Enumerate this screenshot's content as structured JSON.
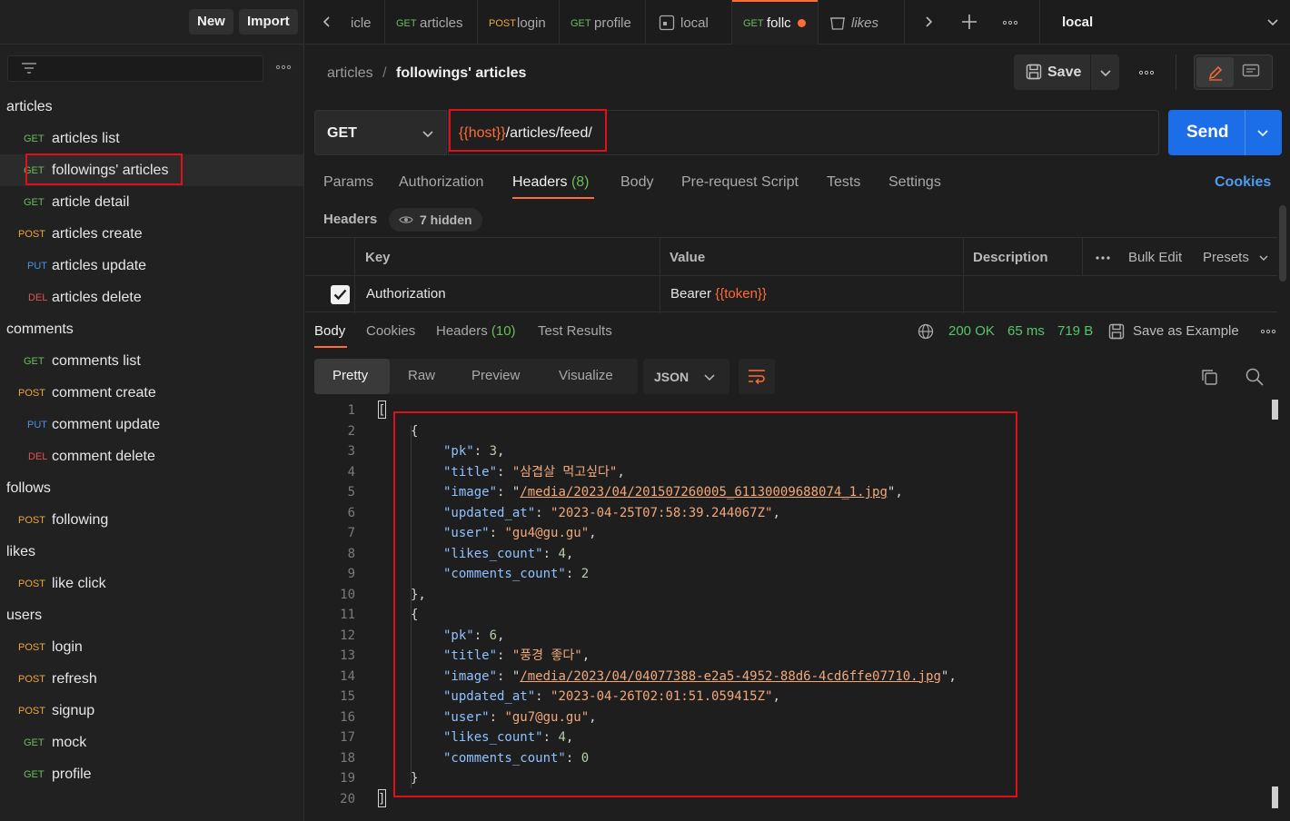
{
  "sidebar": {
    "new_label": "New",
    "import_label": "Import",
    "folders": [
      {
        "name": "articles",
        "items": [
          {
            "method": "GET",
            "label": "articles list"
          },
          {
            "method": "GET",
            "label": "followings' articles"
          },
          {
            "method": "GET",
            "label": "article detail"
          },
          {
            "method": "POST",
            "label": "articles create"
          },
          {
            "method": "PUT",
            "label": "articles update"
          },
          {
            "method": "DEL",
            "label": "articles delete"
          }
        ]
      },
      {
        "name": "comments",
        "items": [
          {
            "method": "GET",
            "label": "comments list"
          },
          {
            "method": "POST",
            "label": "comment create"
          },
          {
            "method": "PUT",
            "label": "comment update"
          },
          {
            "method": "DEL",
            "label": "comment delete"
          }
        ]
      },
      {
        "name": "follows",
        "items": [
          {
            "method": "POST",
            "label": "following"
          }
        ]
      },
      {
        "name": "likes",
        "items": [
          {
            "method": "POST",
            "label": "like click"
          }
        ]
      },
      {
        "name": "users",
        "items": [
          {
            "method": "POST",
            "label": "login"
          },
          {
            "method": "POST",
            "label": "refresh"
          },
          {
            "method": "POST",
            "label": "signup"
          },
          {
            "method": "GET",
            "label": "mock"
          },
          {
            "method": "GET",
            "label": "profile"
          }
        ]
      }
    ]
  },
  "tabs": [
    {
      "method": "",
      "label": "icle"
    },
    {
      "method": "GET",
      "label": "articles"
    },
    {
      "method": "POST",
      "label": "login"
    },
    {
      "method": "GET",
      "label": "profile"
    },
    {
      "method": "",
      "label": "local"
    },
    {
      "method": "GET",
      "label": "follc"
    },
    {
      "method": "",
      "label": "likes"
    }
  ],
  "environment": "local",
  "breadcrumb": {
    "parent": "articles",
    "separator": "/",
    "current": "followings' articles"
  },
  "toolbar": {
    "save_label": "Save"
  },
  "request": {
    "method": "GET",
    "url_var": "{{host}}",
    "url_path": "/articles/feed/",
    "send_label": "Send"
  },
  "request_tabs": {
    "params": "Params",
    "authorization": "Authorization",
    "headers": "Headers",
    "headers_count": "(8)",
    "body": "Body",
    "pre_request": "Pre-request Script",
    "tests": "Tests",
    "settings": "Settings",
    "cookies": "Cookies"
  },
  "headers_section": {
    "title": "Headers",
    "hidden": "7 hidden"
  },
  "headers_table": {
    "col_key": "Key",
    "col_value": "Value",
    "col_description": "Description",
    "bulk_edit": "Bulk Edit",
    "presets": "Presets",
    "rows": [
      {
        "checked": true,
        "key": "Authorization",
        "value_prefix": "Bearer ",
        "value_var": "{{token}}"
      }
    ]
  },
  "response_tabs": {
    "body": "Body",
    "cookies": "Cookies",
    "headers": "Headers",
    "headers_count": "(10)",
    "test_results": "Test Results"
  },
  "response_status": {
    "status": "200 OK",
    "time": "65 ms",
    "size": "719 B",
    "save_example": "Save as Example"
  },
  "response_view": {
    "modes": [
      "Pretty",
      "Raw",
      "Preview",
      "Visualize"
    ],
    "format": "JSON"
  },
  "code_lines": [
    {
      "n": "1",
      "t": "["
    },
    {
      "n": "2",
      "t": "{"
    },
    {
      "n": "3",
      "key": "\"pk\"",
      "val": "3",
      "vt": "n"
    },
    {
      "n": "4",
      "key": "\"title\"",
      "val": "\"삼겹살 먹고싶다\"",
      "vt": "s"
    },
    {
      "n": "5",
      "key": "\"image\"",
      "val": "/media/2023/04/201507260005_61130009688074_1.jpg",
      "vt": "u"
    },
    {
      "n": "6",
      "key": "\"updated_at\"",
      "val": "\"2023-04-25T07:58:39.244067Z\"",
      "vt": "s"
    },
    {
      "n": "7",
      "key": "\"user\"",
      "val": "\"gu4@gu.gu\"",
      "vt": "s"
    },
    {
      "n": "8",
      "key": "\"likes_count\"",
      "val": "4",
      "vt": "n"
    },
    {
      "n": "9",
      "key": "\"comments_count\"",
      "val": "2",
      "vt": "n",
      "last": true
    },
    {
      "n": "10",
      "t": "},"
    },
    {
      "n": "11",
      "t": "{"
    },
    {
      "n": "12",
      "key": "\"pk\"",
      "val": "6",
      "vt": "n"
    },
    {
      "n": "13",
      "key": "\"title\"",
      "val": "\"풍경 좋다\"",
      "vt": "s"
    },
    {
      "n": "14",
      "key": "\"image\"",
      "val": "/media/2023/04/04077388-e2a5-4952-88d6-4cd6ffe07710.jpg",
      "vt": "u"
    },
    {
      "n": "15",
      "key": "\"updated_at\"",
      "val": "\"2023-04-26T02:01:51.059415Z\"",
      "vt": "s"
    },
    {
      "n": "16",
      "key": "\"user\"",
      "val": "\"gu7@gu.gu\"",
      "vt": "s"
    },
    {
      "n": "17",
      "key": "\"likes_count\"",
      "val": "4",
      "vt": "n"
    },
    {
      "n": "18",
      "key": "\"comments_count\"",
      "val": "0",
      "vt": "n",
      "last": true
    },
    {
      "n": "19",
      "t": "}"
    },
    {
      "n": "20",
      "t": "]"
    }
  ],
  "colors": {
    "accent": "#ff6c37",
    "send": "#1c6ee8",
    "highlight": "#e0101b",
    "get": "#6bbd5b",
    "post": "#f0a53a",
    "put": "#4b93e6",
    "del": "#e05252"
  }
}
